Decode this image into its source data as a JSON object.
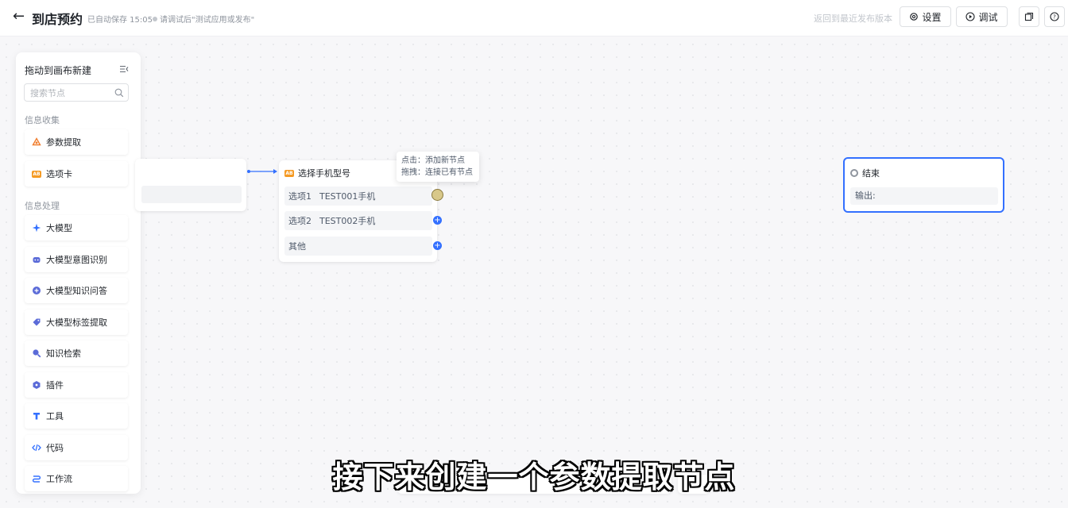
{
  "header": {
    "back_icon": "arrow-left-icon",
    "title": "到店预约",
    "autosave": "已自动保存 15:05",
    "hint": "请调试后\"测试应用或发布\"",
    "restore": "返回到最近发布版本",
    "settings_label": "设置",
    "debug_label": "调试"
  },
  "palette": {
    "title": "拖动到画布新建",
    "search_placeholder": "搜索节点",
    "groups": [
      {
        "label": "信息收集",
        "items": [
          {
            "label": "参数提取",
            "icon": "triangle-nodes-icon",
            "color": "#f07d2e"
          },
          {
            "label": "选项卡",
            "icon": "ab-badge-icon",
            "color": "#f59a23"
          }
        ]
      },
      {
        "label": "信息处理",
        "items": [
          {
            "label": "大模型",
            "icon": "sparkle-icon",
            "color": "#3370ff"
          },
          {
            "label": "大模型意图识别",
            "icon": "robot-icon",
            "color": "#5b6bd8"
          },
          {
            "label": "大模型知识问答",
            "icon": "plus-circle-icon",
            "color": "#5b6bd8"
          },
          {
            "label": "大模型标签提取",
            "icon": "tag-icon",
            "color": "#5b6bd8"
          },
          {
            "label": "知识检索",
            "icon": "search-icon",
            "color": "#5b6bd8"
          },
          {
            "label": "插件",
            "icon": "plugin-icon",
            "color": "#5b6bd8"
          },
          {
            "label": "工具",
            "icon": "tool-icon",
            "color": "#3370ff"
          },
          {
            "label": "代码",
            "icon": "code-icon",
            "color": "#3370ff"
          },
          {
            "label": "工作流",
            "icon": "workflow-icon",
            "color": "#3370ff"
          }
        ]
      }
    ]
  },
  "nodes": {
    "select": {
      "title": "选择手机型号",
      "options": [
        {
          "name": "选项1",
          "value": "TEST001手机"
        },
        {
          "name": "选项2",
          "value": "TEST002手机"
        },
        {
          "name": "其他",
          "value": ""
        }
      ]
    },
    "tooltip": {
      "line1": "点击：添加新节点",
      "line2": "拖拽：连接已有节点"
    },
    "end": {
      "title": "结束",
      "output_label": "输出:"
    }
  },
  "subtitle": "接下来创建一个参数提取节点"
}
